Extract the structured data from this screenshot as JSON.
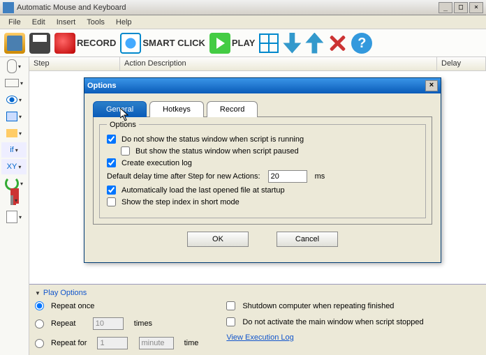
{
  "window": {
    "title": "Automatic Mouse and Keyboard"
  },
  "menu": {
    "file": "File",
    "edit": "Edit",
    "insert": "Insert",
    "tools": "Tools",
    "help": "Help"
  },
  "toolbar": {
    "record": "RECORD",
    "smart_click": "SMART CLICK",
    "play": "PLAY",
    "help_glyph": "?"
  },
  "columns": {
    "step": "Step",
    "action": "Action Description",
    "delay": "Delay"
  },
  "sidebar": {
    "if_label": "if",
    "xy_label": "XY"
  },
  "play_options": {
    "title": "Play Options",
    "repeat_once": "Repeat once",
    "repeat": "Repeat",
    "repeat_val": "10",
    "times": "times",
    "repeat_for": "Repeat for",
    "repeat_for_val": "1",
    "repeat_for_unit": "minute",
    "time": "time",
    "shutdown": "Shutdown computer when repeating finished",
    "no_activate": "Do not activate the main window when script stopped",
    "view_log": "View Execution Log"
  },
  "dialog": {
    "title": "Options",
    "tabs": {
      "general": "General",
      "hotkeys": "Hotkeys",
      "record": "Record"
    },
    "group": "Options",
    "opt1": "Do not show the status window when script is running",
    "opt1a": "But show the status window when script paused",
    "opt2": "Create execution log",
    "delay_label": "Default delay time after Step for new Actions:",
    "delay_value": "20",
    "delay_unit": "ms",
    "opt3": "Automatically load the last opened file at startup",
    "opt4": "Show the step index in short mode",
    "ok": "OK",
    "cancel": "Cancel"
  }
}
